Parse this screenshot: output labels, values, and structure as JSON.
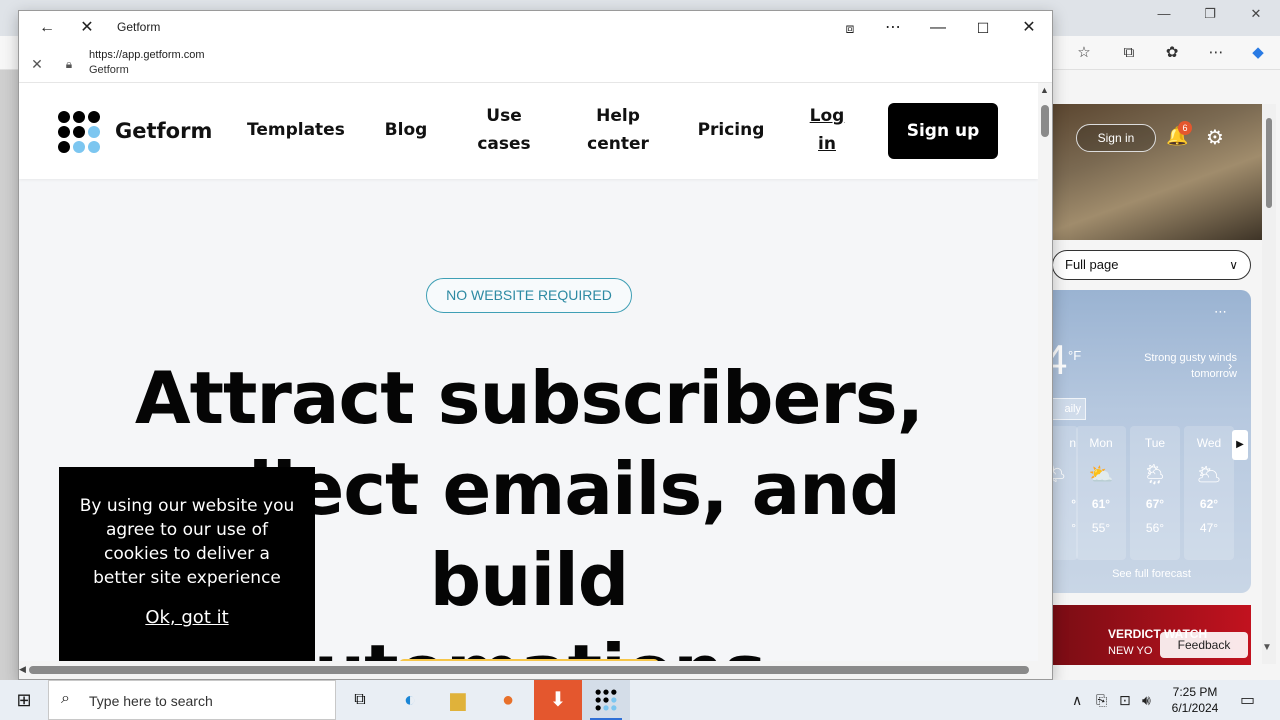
{
  "popup": {
    "title": "Getform",
    "url": "https://app.getform.com",
    "url_sub": "Getform"
  },
  "site": {
    "brand": "Getform",
    "nav": {
      "templates": "Templates",
      "blog": "Blog",
      "use_cases_1": "Use",
      "use_cases_2": "cases",
      "help_center_1": "Help",
      "help_center_2": "center",
      "pricing": "Pricing",
      "login_1": "Log",
      "login_2": "in",
      "signup": "Sign up"
    },
    "badge": "NO WEBSITE REQUIRED",
    "headline_1": "Attract subscribers,",
    "headline_2": "collect emails, and build",
    "headline_3": "automations.",
    "cookie": {
      "text": "By using our website you agree to our use of cookies to deliver a better site experience",
      "ok": "Ok, got it"
    }
  },
  "background_browser": {
    "sign_in": "Sign in",
    "notification_count": "6",
    "page_mode": "Full page",
    "weather": {
      "temp_partial": "4",
      "unit": "°F",
      "note": "Strong gusty winds tomorrow",
      "tab": "aily",
      "days": [
        {
          "day": "n",
          "hi": "°",
          "lo": "°"
        },
        {
          "day": "Mon",
          "hi": "61°",
          "lo": "55°"
        },
        {
          "day": "Tue",
          "hi": "67°",
          "lo": "56°"
        },
        {
          "day": "Wed",
          "hi": "62°",
          "lo": "47°"
        }
      ],
      "full_forecast": "See full forecast"
    },
    "news_title": "VERDICT WATCH",
    "news_sub": "NEW YO",
    "feedback": "Feedback"
  },
  "taskbar": {
    "search_placeholder": "Type here to search",
    "time": "7:25 PM",
    "date": "6/1/2024"
  }
}
